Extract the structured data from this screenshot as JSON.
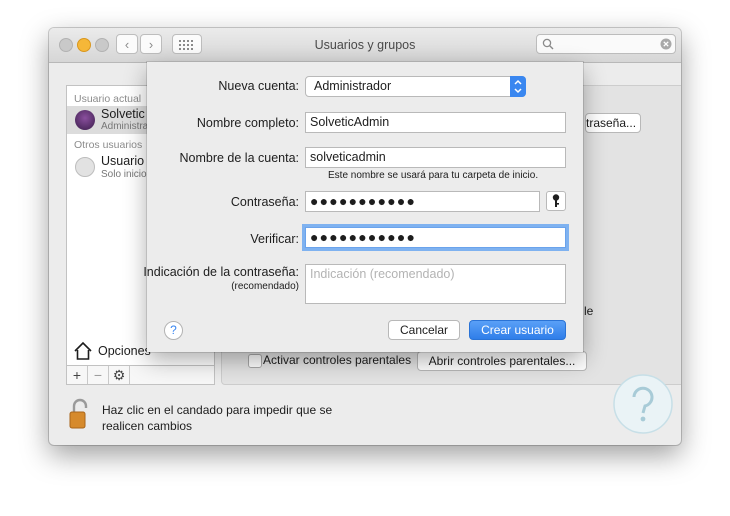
{
  "window": {
    "title": "Usuarios y grupos"
  },
  "sidebar": {
    "current_header": "Usuario actual",
    "current_user_name": "Solvetic",
    "current_user_role": "Administrador",
    "others_header": "Otros usuarios",
    "other_user_name": "Usuario i",
    "other_user_role": "Solo inicio",
    "login_options": "Opciones",
    "add_symbol": "+",
    "remove_symbol": "−",
    "gear_symbol": "✱"
  },
  "pane": {
    "change_password_button": "traseña...",
    "parental_checkbox_label": "Activar controles parentales",
    "parental_button": "Abrir controles parentales...",
    "partial_text": "le"
  },
  "lock": {
    "line1": "Haz clic en el candado para impedir que se",
    "line2": "realicen cambios"
  },
  "sheet": {
    "new_account_label": "Nueva cuenta:",
    "new_account_value": "Administrador",
    "full_name_label": "Nombre completo:",
    "full_name_value": "SolveticAdmin",
    "account_name_label": "Nombre de la cuenta:",
    "account_name_value": "solveticadmin",
    "account_name_hint": "Este nombre se usará para tu carpeta de inicio.",
    "password_label": "Contraseña:",
    "password_value": "●●●●●●●●●●●",
    "verify_label": "Verificar:",
    "verify_value": "●●●●●●●●●●●",
    "hint_label": "Indicación de la contraseña:",
    "hint_sublabel": "(recomendado)",
    "hint_placeholder": "Indicación (recomendado)",
    "help_symbol": "?",
    "cancel_button": "Cancelar",
    "create_button": "Crear usuario"
  },
  "colors": {
    "accent": "#3a87f0",
    "focus_ring": "#7fb2f0"
  },
  "icons": [
    "back-chevron-icon",
    "forward-chevron-icon",
    "grid-icon",
    "search-icon",
    "clear-icon",
    "avatar-icon",
    "home-icon",
    "gear-icon",
    "lock-icon",
    "key-icon",
    "help-icon",
    "watermark-logo-icon"
  ]
}
